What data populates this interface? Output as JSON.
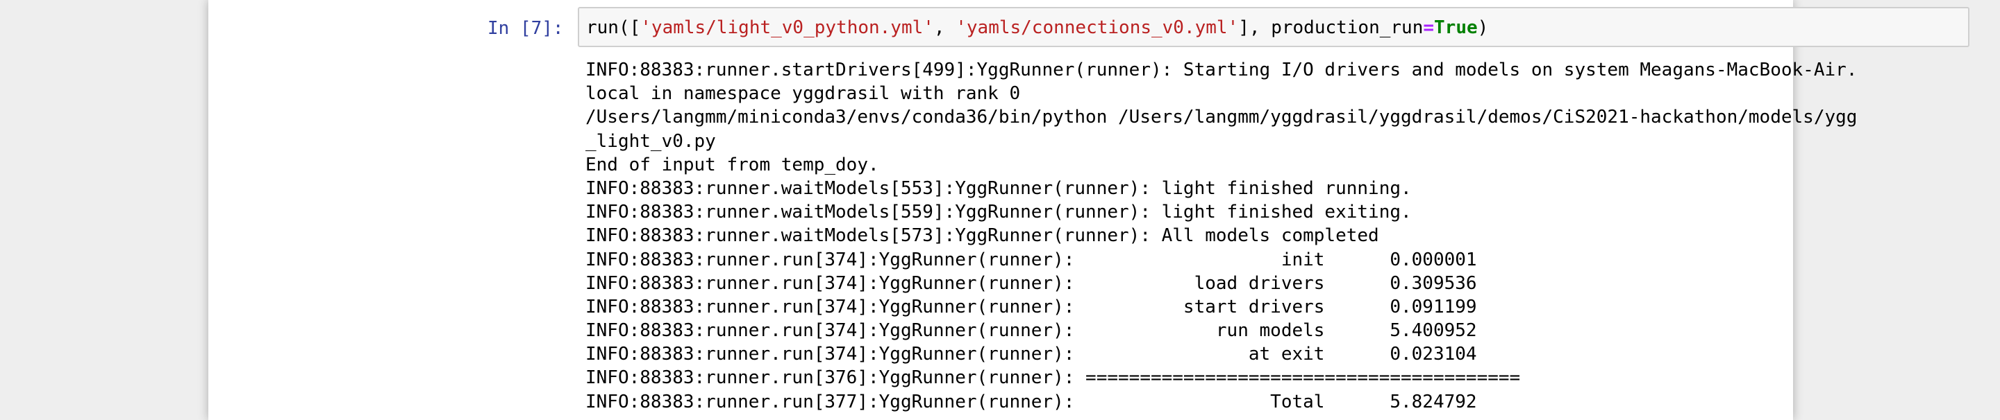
{
  "cell": {
    "prompt": "In [7]:",
    "code": {
      "func": "run",
      "open": "([",
      "arg1": "'yamls/light_v0_python.yml'",
      "sep": ", ",
      "arg2": "'yamls/connections_v0.yml'",
      "close_list": "], ",
      "kwarg": "production_run",
      "eq": "=",
      "value": "True",
      "close": ")"
    },
    "output_lines": [
      "INFO:88383:runner.startDrivers[499]:YggRunner(runner): Starting I/O drivers and models on system Meagans-MacBook-Air.",
      "local in namespace yggdrasil with rank 0",
      "/Users/langmm/miniconda3/envs/conda36/bin/python /Users/langmm/yggdrasil/yggdrasil/demos/CiS2021-hackathon/models/ygg",
      "_light_v0.py",
      "End of input from temp_doy.",
      "INFO:88383:runner.waitModels[553]:YggRunner(runner): light finished running.",
      "INFO:88383:runner.waitModels[559]:YggRunner(runner): light finished exiting.",
      "INFO:88383:runner.waitModels[573]:YggRunner(runner): All models completed",
      "INFO:88383:runner.run[374]:YggRunner(runner):                   init      0.000001",
      "INFO:88383:runner.run[374]:YggRunner(runner):           load drivers      0.309536",
      "INFO:88383:runner.run[374]:YggRunner(runner):          start drivers      0.091199",
      "INFO:88383:runner.run[374]:YggRunner(runner):             run models      5.400952",
      "INFO:88383:runner.run[374]:YggRunner(runner):                at exit      0.023104",
      "INFO:88383:runner.run[376]:YggRunner(runner): ========================================",
      "INFO:88383:runner.run[377]:YggRunner(runner):                  Total      5.824792"
    ]
  },
  "colors": {
    "prompt": "#303f9f",
    "string": "#ba2121",
    "operator": "#aa22ff",
    "keyword": "#008000",
    "input_bg": "#f7f7f7",
    "page_bg": "#eeeeee"
  }
}
